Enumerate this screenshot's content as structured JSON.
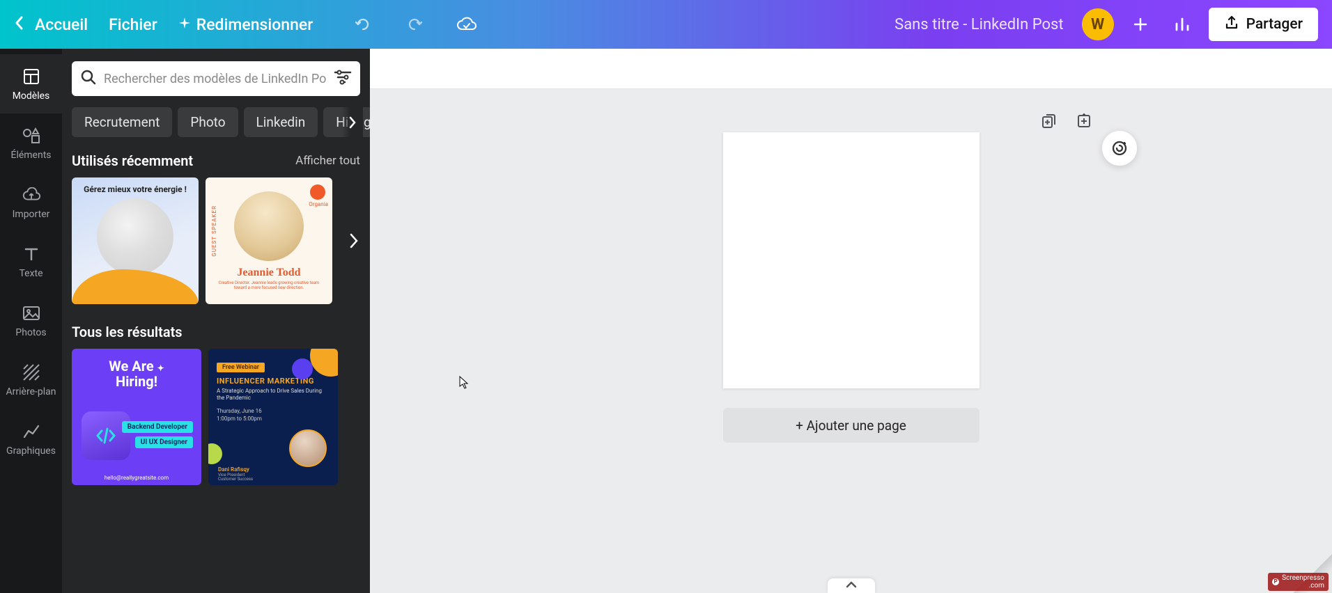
{
  "topbar": {
    "home": "Accueil",
    "file": "Fichier",
    "resize": "Redimensionner",
    "doc_title": "Sans titre - LinkedIn Post",
    "avatar_initial": "W",
    "share": "Partager"
  },
  "rail": {
    "items": [
      {
        "label": "Modèles"
      },
      {
        "label": "Éléments"
      },
      {
        "label": "Importer"
      },
      {
        "label": "Texte"
      },
      {
        "label": "Photos"
      },
      {
        "label": "Arrière-plan"
      },
      {
        "label": "Graphiques"
      }
    ]
  },
  "panel": {
    "search_placeholder": "Rechercher des modèles de LinkedIn Post",
    "chips": [
      "Recrutement",
      "Photo",
      "Linkedin",
      "Hiring"
    ],
    "recent": {
      "title": "Utilisés récemment",
      "action": "Afficher tout"
    },
    "results": {
      "title": "Tous les résultats"
    },
    "templates": {
      "t1_title": "Gérez mieux votre énergie !",
      "t2_tag": "Organia",
      "t2_side": "GUEST SPEAKER",
      "t2_name": "Jeannie Todd",
      "t2_sub": "Creative Director. Jeannie leads growing creative team toward a more focused new direction.",
      "t3_title1": "We Are",
      "t3_title2": "Hiring!",
      "t3_pill1": "Backend Developer",
      "t3_pill2": "UI UX Designer",
      "t3_foot": "hello@reallygreatsite.com",
      "t4_tag": "Free Webinar",
      "t4_title": "INFLUENCER MARKETING",
      "t4_sub": "A Strategic Approach to Drive Sales During the Pandemic",
      "t4_date": "Thursday, June 16",
      "t4_time": "1:00pm to 5:00pm",
      "t4_speaker": "Dani Rafisqy",
      "t4_role1": "Vice President",
      "t4_role2": "Customer Success"
    }
  },
  "canvas": {
    "add_page": "+ Ajouter une page"
  },
  "watermark": {
    "text": "Screenpresso",
    "sub": ".com"
  }
}
